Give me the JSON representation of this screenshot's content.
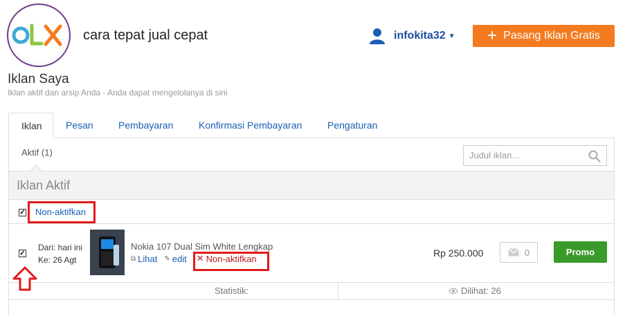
{
  "header": {
    "logo_text": "OLX",
    "tagline": "cara tepat jual cepat",
    "user_name": "infokita32",
    "post_button_label": "Pasang Iklan Gratis"
  },
  "page": {
    "title": "Iklan Saya",
    "subtitle": "Iklan aktif dan arsip Anda - Anda dapat mengelolanya di sini"
  },
  "tabs": [
    {
      "label": "Iklan",
      "active": true
    },
    {
      "label": "Pesan"
    },
    {
      "label": "Pembayaran"
    },
    {
      "label": "Konfirmasi Pembayaran"
    },
    {
      "label": "Pengaturan"
    }
  ],
  "filter": {
    "label": "Aktif (1)",
    "search_placeholder": "Judul iklan..."
  },
  "section": {
    "title": "Iklan Aktif",
    "bulk_action": "Non-aktifkan",
    "bulk_checked": true
  },
  "ad": {
    "checked": true,
    "date_from": "Dari: hari ini",
    "date_to": "Ke: 26 Agt",
    "title": "Nokia 107 Dual Sim White Lengkap",
    "view_label": "Lihat",
    "edit_label": "edit",
    "deactivate_label": "Non-aktifkan",
    "price": "Rp 250.000",
    "message_count": "0",
    "promo_label": "Promo"
  },
  "stats": {
    "label": "Statistik:",
    "views": "Dilihat: 26"
  },
  "colors": {
    "accent_orange": "#f47b20",
    "link_blue": "#1a5fb4",
    "promo_green": "#3a9a2a",
    "highlight_red": "#e21a1a"
  },
  "icons": [
    "olx-logo",
    "user-icon",
    "chevron-down-icon",
    "plus-icon",
    "search-icon",
    "external-link-icon",
    "pencil-icon",
    "close-icon",
    "envelope-icon",
    "eye-icon",
    "arrow-up-icon"
  ]
}
